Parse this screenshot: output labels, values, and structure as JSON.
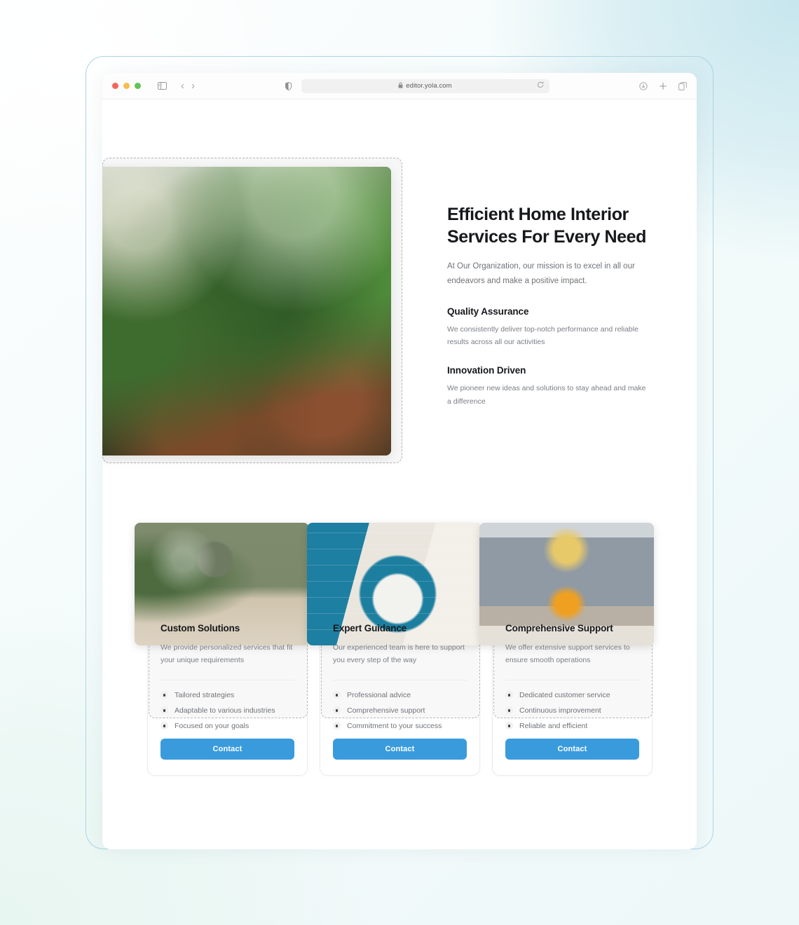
{
  "browser": {
    "url": "editor.yola.com",
    "lock_icon": "lock-icon",
    "reload_icon": "reload-icon",
    "shield_icon": "shield-icon",
    "sidebar_icon": "sidebar-toggle-icon",
    "back_icon": "chevron-left-icon",
    "forward_icon": "chevron-right-icon",
    "download_icon": "download-icon",
    "new_tab_icon": "plus-icon",
    "tab_overview_icon": "tab-overview-icon",
    "traffic_lights": [
      "close",
      "minimize",
      "zoom"
    ]
  },
  "hero": {
    "title": "Efficient Home Interior Services For Every Need",
    "subtitle": "At Our Organization, our mission is to excel in all our endeavors and make a positive impact.",
    "image_alt": "indoor-plants-staircase-photo",
    "features": [
      {
        "title": "Quality Assurance",
        "body": "We consistently deliver top-notch performance and reliable results across all our activities"
      },
      {
        "title": "Innovation Driven",
        "body": "We pioneer new ideas and solutions to stay ahead and make a difference"
      }
    ]
  },
  "cards": [
    {
      "title": "Custom Solutions",
      "description": "We provide personalized services that fit your unique requirements",
      "image_alt": "green-living-room-sideboard-photo",
      "bullets": [
        "Tailored strategies",
        "Adaptable to various industries",
        "Focused on your goals"
      ],
      "button": "Contact"
    },
    {
      "title": "Expert Guidance",
      "description": "Our experienced team is here to support you every step of the way",
      "image_alt": "blue-arch-yellow-chair-photo",
      "bullets": [
        "Professional advice",
        "Comprehensive support",
        "Commitment to your success"
      ],
      "button": "Contact"
    },
    {
      "title": "Comprehensive Support",
      "description": "We offer extensive support services to ensure smooth operations",
      "image_alt": "grey-library-fireplace-photo",
      "bullets": [
        "Dedicated customer service",
        "Continuous improvement",
        "Reliable and efficient"
      ],
      "button": "Contact"
    }
  ],
  "colors": {
    "accent": "#3a9bdc",
    "heading": "#16181c",
    "body_text": "#7b7e83",
    "frame_border": "#aed3e4",
    "selection_dash": "#b4b4b4"
  }
}
